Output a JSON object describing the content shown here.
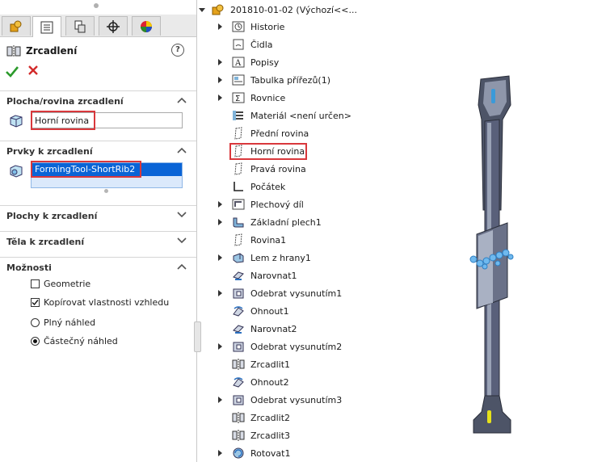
{
  "property_manager": {
    "tabs": [
      "feature-manager-tab",
      "property-manager-tab",
      "configuration-manager-tab",
      "dimxpert-tab",
      "appearance-tab"
    ],
    "title": "Zrcadlení",
    "help": "?",
    "sections": {
      "mirror_face": {
        "label": "Plocha/rovina zrcadlení",
        "value": "Horní rovina"
      },
      "features": {
        "label": "Prvky k zrcadlení",
        "items": [
          "FormingTool-ShortRib2"
        ]
      },
      "faces": {
        "label": "Plochy k zrcadlení"
      },
      "bodies": {
        "label": "Těla k zrcadlení"
      },
      "options": {
        "label": "Možnosti",
        "geometry": "Geometrie",
        "geometry_checked": false,
        "copy_appearance": "Kopírovat vlastnosti vzhledu",
        "copy_appearance_checked": true,
        "full_preview": "Plný náhled",
        "partial_preview": "Částečný náhled",
        "selected_preview": "partial"
      }
    }
  },
  "tree": {
    "root": "201810-01-02  (Výchozí<<...",
    "items": [
      {
        "label": "Historie",
        "icon": "history-folder-icon",
        "expandable": true
      },
      {
        "label": "Čidla",
        "icon": "sensors-icon",
        "expandable": false
      },
      {
        "label": "Popisy",
        "icon": "annotations-icon",
        "expandable": true
      },
      {
        "label": "Tabulka přířezů(1)",
        "icon": "cut-list-icon",
        "expandable": true
      },
      {
        "label": "Rovnice",
        "icon": "equations-icon",
        "expandable": true
      },
      {
        "label": "Materiál <není určen>",
        "icon": "material-icon",
        "expandable": false
      },
      {
        "label": "Přední rovina",
        "icon": "plane-icon",
        "expandable": false
      },
      {
        "label": "Horní rovina",
        "icon": "plane-icon",
        "expandable": false,
        "highlighted": true
      },
      {
        "label": "Pravá rovina",
        "icon": "plane-icon",
        "expandable": false
      },
      {
        "label": "Počátek",
        "icon": "origin-icon",
        "expandable": false
      },
      {
        "label": "Plechový díl",
        "icon": "sheet-metal-icon",
        "expandable": true
      },
      {
        "label": "Základní plech1",
        "icon": "base-flange-icon",
        "expandable": true
      },
      {
        "label": "Rovina1",
        "icon": "plane-icon",
        "expandable": false
      },
      {
        "label": "Lem z hrany1",
        "icon": "edge-flange-icon",
        "expandable": true
      },
      {
        "label": "Narovnat1",
        "icon": "unfold-icon",
        "expandable": false
      },
      {
        "label": "Odebrat vysunutím1",
        "icon": "cut-extrude-icon",
        "expandable": true
      },
      {
        "label": "Ohnout1",
        "icon": "fold-icon",
        "expandable": false
      },
      {
        "label": "Narovnat2",
        "icon": "unfold-icon",
        "expandable": false
      },
      {
        "label": "Odebrat vysunutím2",
        "icon": "cut-extrude-icon",
        "expandable": true
      },
      {
        "label": "Zrcadlit1",
        "icon": "mirror-icon",
        "expandable": false
      },
      {
        "label": "Ohnout2",
        "icon": "fold-icon",
        "expandable": false
      },
      {
        "label": "Odebrat vysunutím3",
        "icon": "cut-extrude-icon",
        "expandable": true
      },
      {
        "label": "Zrcadlit2",
        "icon": "mirror-icon",
        "expandable": false
      },
      {
        "label": "Zrcadlit3",
        "icon": "mirror-icon",
        "expandable": false
      },
      {
        "label": "Rotovat1",
        "icon": "rotate-icon",
        "expandable": true
      }
    ]
  },
  "colors": {
    "highlight": "#d9383c",
    "selection": "#0a64d6",
    "part": "#4a5060",
    "part_light": "#9aa3b6",
    "tool_blue": "#3a9ad9",
    "marker_yellow": "#e6e11a"
  }
}
